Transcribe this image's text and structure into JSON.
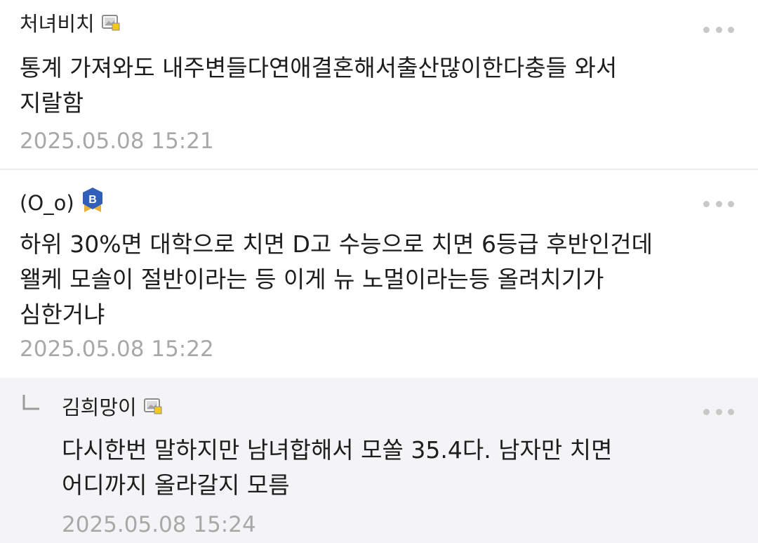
{
  "comments": [
    {
      "author": "처녀비치",
      "author_icon": "image-badge-icon",
      "text": "통계 가져와도 내주변들다연애결혼해서출산많이한다충들 와서\n지랄함",
      "date": "2025.05.08 15:21"
    },
    {
      "author": "(O_o)",
      "author_icon": "blue-b-shield-badge-icon",
      "text": "하위 30%면 대학으로 치면 D고 수능으로 치면 6등급 후반인건데\n왤케 모솔이 절반이라는 등 이게 뉴 노멀이라는등 올려치기가\n심한거냐",
      "date": "2025.05.08 15:22"
    },
    {
      "author": "김희망이",
      "author_icon": "image-badge-icon",
      "is_reply": true,
      "text": "다시한번 말하지만 남녀합해서 모쏠 35.4다. 남자만 치면\n어디까지 올라갈지 모름",
      "date": "2025.05.08 15:24"
    }
  ],
  "colors": {
    "reply_background": "#f4f4f7",
    "date_text": "#a8a8a8",
    "badge_blue": "#2f5fb8",
    "badge_gold": "#e8b23a"
  }
}
